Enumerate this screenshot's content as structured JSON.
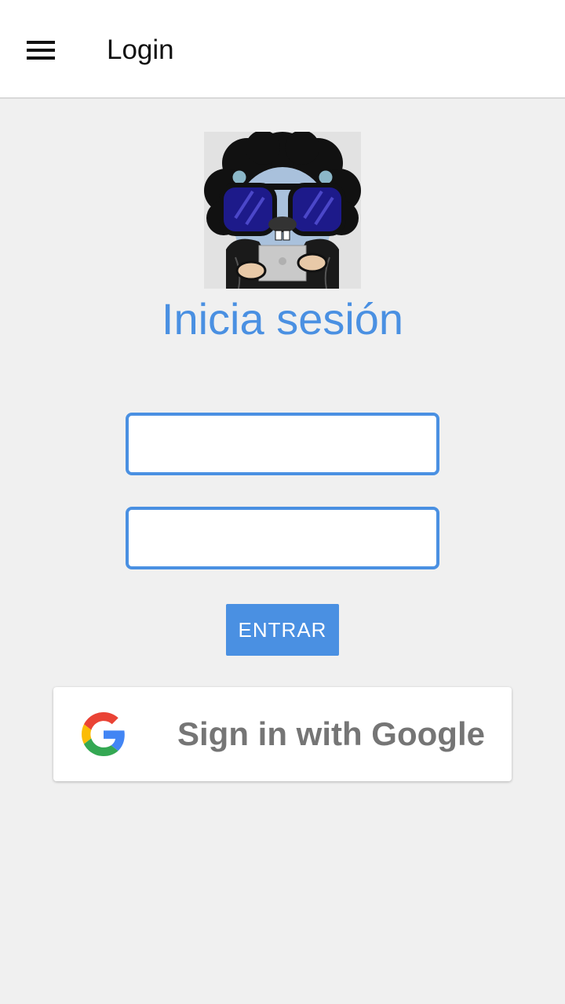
{
  "header": {
    "title": "Login",
    "menu_icon": "menu-icon"
  },
  "main": {
    "heading": "Inicia sesión",
    "avatar_icon": "gopher-with-sunglasses-avatar",
    "username": {
      "value": "",
      "placeholder": ""
    },
    "password": {
      "value": "",
      "placeholder": ""
    },
    "submit_label": "ENTRAR",
    "google_label": "Sign in with Google",
    "google_icon": "google-g-icon"
  },
  "colors": {
    "accent": "#4a90e2",
    "background": "#f0f0f0",
    "appbar": "#ffffff",
    "google_text": "#757575"
  }
}
